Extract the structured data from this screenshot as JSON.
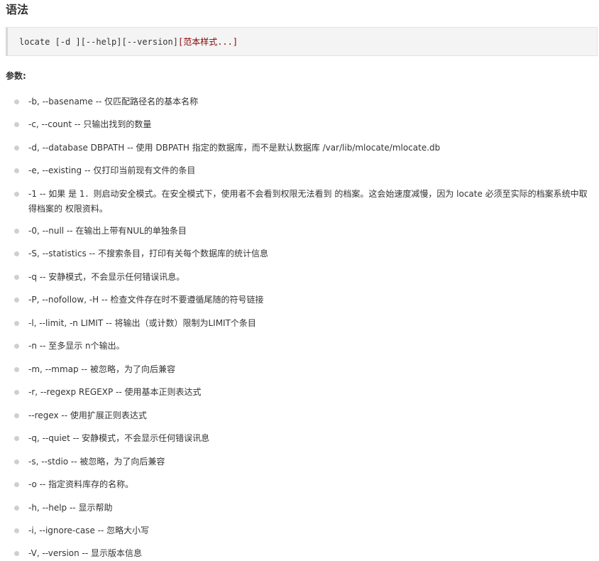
{
  "heading": "语法",
  "syntax": {
    "command": "locate [-d ][--help][--version]",
    "pattern": "[范本样式...]"
  },
  "params_label": "参数:",
  "options": [
    "-b, --basename -- 仅匹配路径名的基本名称",
    "-c, --count -- 只输出找到的数量",
    "-d, --database DBPATH -- 使用 DBPATH 指定的数据库，而不是默认数据库 /var/lib/mlocate/mlocate.db",
    "-e, --existing -- 仅打印当前现有文件的条目",
    "-1 -- 如果 是 1．则启动安全模式。在安全模式下，使用者不会看到权限无法看到 的档案。这会始速度减慢，因为 locate 必须至实际的档案系统中取得档案的 权限资料。",
    "-0, --null -- 在输出上带有NUL的单独条目",
    "-S, --statistics -- 不搜索条目，打印有关每个数据库的统计信息",
    "-q -- 安静模式，不会显示任何错误讯息。",
    "-P, --nofollow, -H -- 检查文件存在时不要遵循尾随的符号链接",
    "-l, --limit, -n LIMIT -- 将输出（或计数）限制为LIMIT个条目",
    "-n -- 至多显示 n个输出。",
    "-m, --mmap -- 被忽略，为了向后兼容",
    "-r, --regexp REGEXP -- 使用基本正则表达式",
    "--regex -- 使用扩展正则表达式",
    "-q, --quiet -- 安静模式，不会显示任何错误讯息",
    "-s, --stdio -- 被忽略，为了向后兼容",
    "-o -- 指定资料库存的名称。",
    "-h, --help -- 显示帮助",
    "-i, --ignore-case -- 忽略大小写",
    "-V, --version -- 显示版本信息"
  ]
}
